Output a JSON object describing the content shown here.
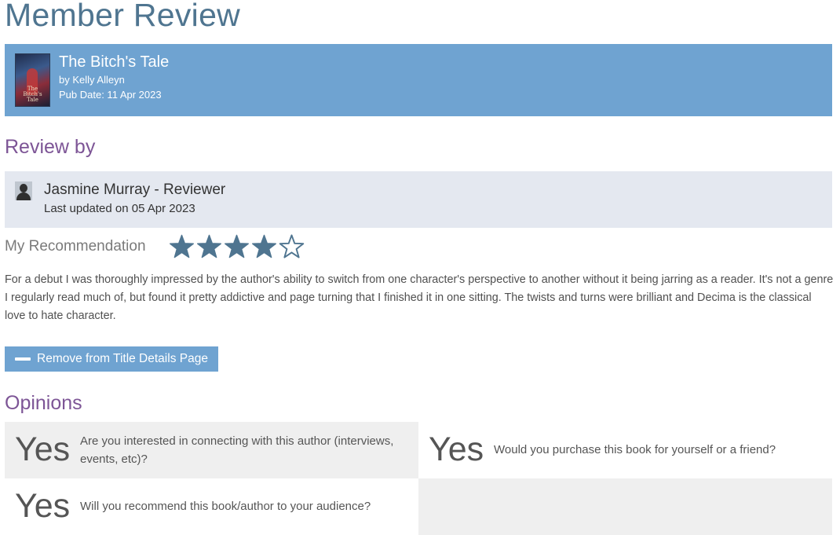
{
  "page_title": "Member Review",
  "book": {
    "title": "The Bitch's Tale",
    "author": "by Kelly Alleyn",
    "pub_date": "Pub Date: 11 Apr 2023",
    "cover_text": "The Bitch's Tale"
  },
  "review_by": {
    "heading": "Review by",
    "reviewer_name": "Jasmine Murray - Reviewer",
    "last_updated": "Last updated on 05 Apr 2023",
    "avatar_icon": "user-silhouette-icon"
  },
  "recommendation": {
    "label": "My Recommendation",
    "rating": 4,
    "max_rating": 5,
    "star_filled_color": "#4f7590",
    "star_empty_color": "#4f7590"
  },
  "review_text": "For a debut I was thoroughly impressed by the author's ability to switch from one character's perspective to another without it being jarring as a reader. It's not a genre I regularly read much of, but found it pretty addictive and page turning that I finished it in one sitting. The twists and turns were brilliant and Decima is the classical love to hate character.",
  "remove_button": {
    "label": "Remove from Title Details Page",
    "icon": "minus-icon"
  },
  "opinions": {
    "heading": "Opinions",
    "items": [
      {
        "answer": "Yes",
        "question": "Are you interested in connecting with this author (interviews, events, etc)?"
      },
      {
        "answer": "Yes",
        "question": "Would you purchase this book for yourself or a friend?"
      },
      {
        "answer": "Yes",
        "question": "Will you recommend this book/author to your audience?"
      }
    ]
  },
  "colors": {
    "title_blue": "#4f7590",
    "banner_blue": "#6fa3d1",
    "heading_purple": "#7d5596",
    "reviewer_bg": "#e4e8f0",
    "opinion_bg": "#efefef"
  }
}
